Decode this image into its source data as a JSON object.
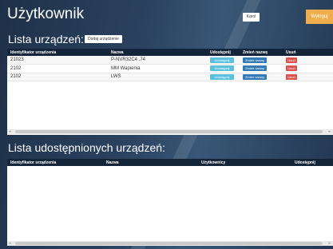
{
  "header": {
    "title": "Użytkownik",
    "user_box": "Karol",
    "action_button": "Wyloguj"
  },
  "devices": {
    "title": "Lista urządzeń:",
    "add_button": "Dodaj urządzenie",
    "columns": [
      "Identyfikator urządzenia",
      "Nazwa",
      "Udostępnij",
      "Zmień nazwę",
      "Usuń"
    ],
    "rows": [
      {
        "id": "21023",
        "name": "P-NVR32C4 .74",
        "share": "Udostępnij",
        "rename": "Zmień nazwę",
        "delete": "Usuń"
      },
      {
        "id": "2102",
        "name": "MM Wapienia",
        "share": "Udostępnij",
        "rename": "Zmień nazwę",
        "delete": "Usuń"
      },
      {
        "id": "2102",
        "name": "LWS",
        "share": "Udostępnij",
        "rename": "Zmień nazwę",
        "delete": "Usuń"
      }
    ]
  },
  "shared": {
    "title": "Lista udostępnionych urządzeń:",
    "columns": [
      "Identyfikator urządzenia",
      "Nazwa",
      "Użytkownicy",
      "Udostępnij"
    ],
    "rows": []
  },
  "colors": {
    "share": "#5bc0de",
    "rename": "#337ab7",
    "delete": "#d9534f",
    "logout": "#f0ad4e",
    "table_header": "#14253a"
  }
}
